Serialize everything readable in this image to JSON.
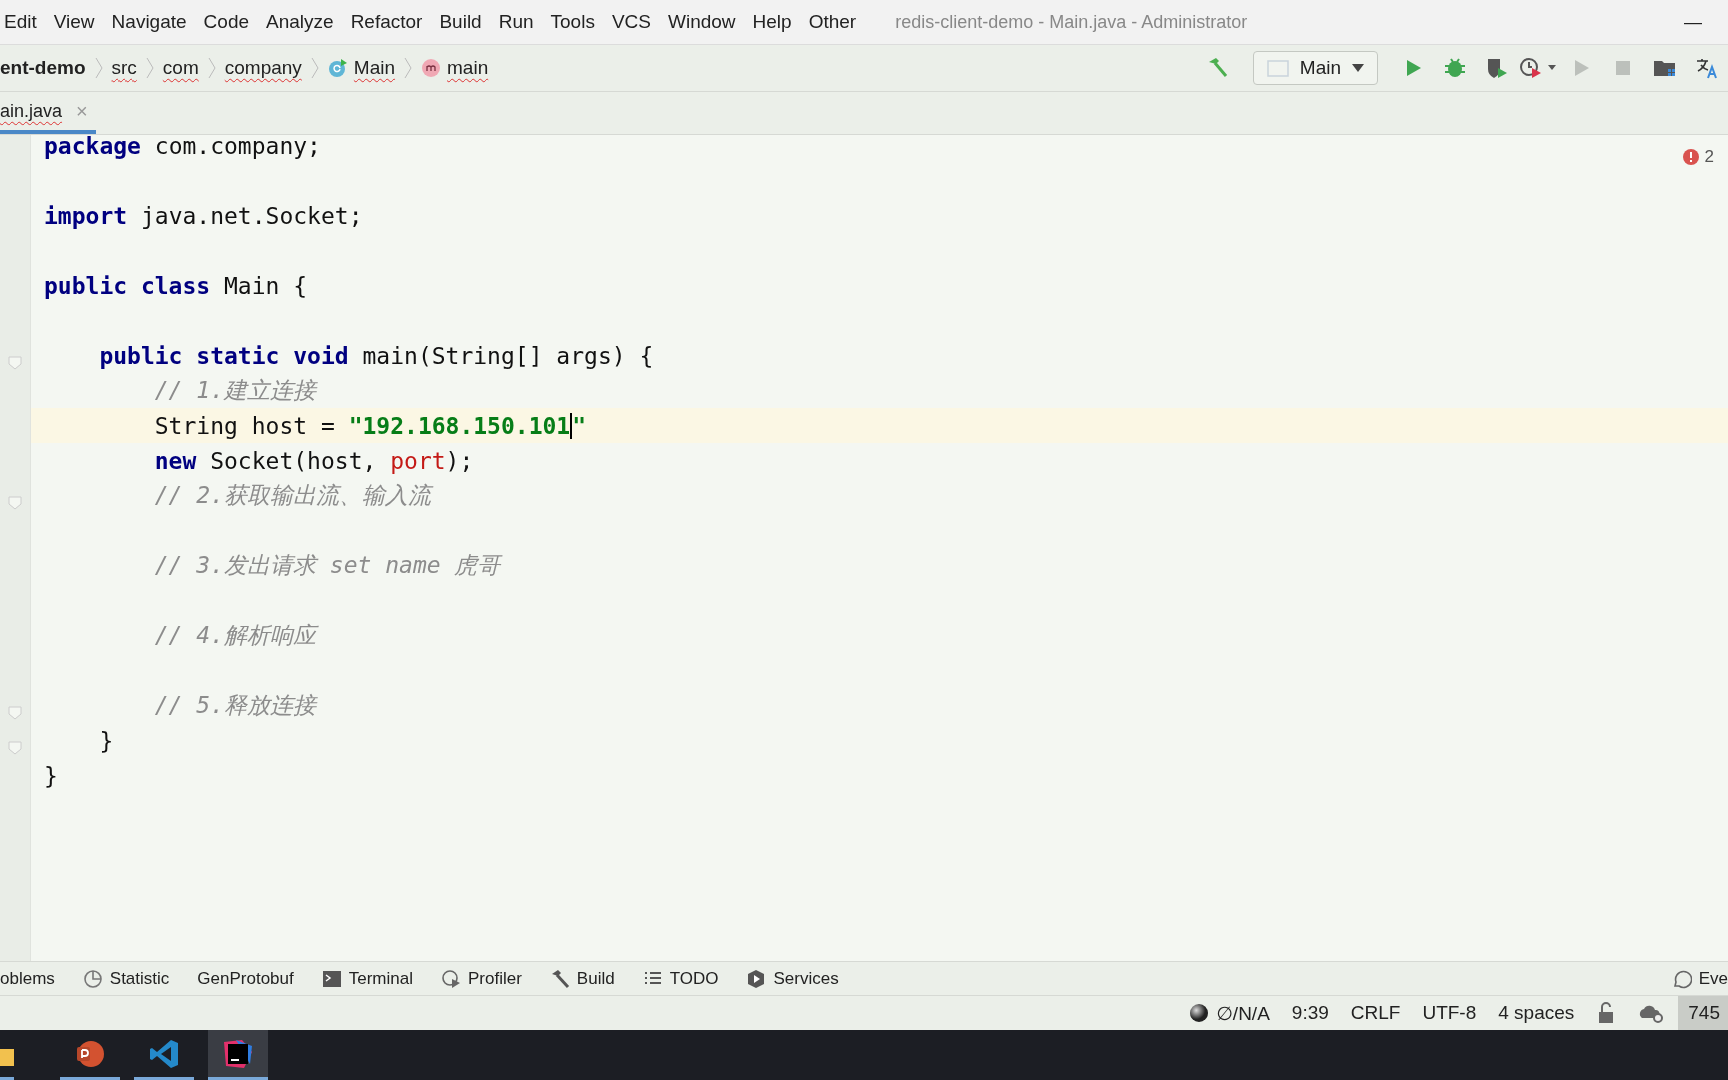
{
  "menu": [
    "Edit",
    "View",
    "Navigate",
    "Code",
    "Analyze",
    "Refactor",
    "Build",
    "Run",
    "Tools",
    "VCS",
    "Window",
    "Help",
    "Other"
  ],
  "window": {
    "title": "redis-client-demo - Main.java - Administrator",
    "minimize": "—"
  },
  "breadcrumbs": [
    {
      "label": "ent-demo",
      "kind": "project",
      "flagged": false
    },
    {
      "label": "src",
      "kind": "folder",
      "flagged": true
    },
    {
      "label": "com",
      "kind": "folder",
      "flagged": true
    },
    {
      "label": "company",
      "kind": "folder",
      "flagged": true
    },
    {
      "label": "Main",
      "kind": "class",
      "flagged": true
    },
    {
      "label": "main",
      "kind": "method",
      "flagged": true
    }
  ],
  "run_config": {
    "label": "Main"
  },
  "toolbar": [
    {
      "kind": "build",
      "disabled": false
    },
    {
      "kind": "run",
      "disabled": false
    },
    {
      "kind": "debug",
      "disabled": false
    },
    {
      "kind": "coverage",
      "disabled": false
    },
    {
      "kind": "profile",
      "disabled": false
    },
    {
      "kind": "rerun",
      "disabled": true
    },
    {
      "kind": "stop",
      "disabled": true
    },
    {
      "kind": "structure",
      "disabled": false
    },
    {
      "kind": "translate",
      "disabled": false
    }
  ],
  "tabs": [
    {
      "label": "ain.java",
      "selected": true,
      "close": "×"
    }
  ],
  "problems": {
    "count": "2"
  },
  "code": [
    {
      "current": false,
      "fold": false,
      "tokens": [
        {
          "text": "package",
          "kind": "keyword"
        },
        {
          "text": " com.company;",
          "kind": "plain"
        }
      ]
    },
    {
      "current": false,
      "fold": false
    },
    {
      "current": false,
      "fold": false,
      "tokens": [
        {
          "text": "import",
          "kind": "keyword"
        },
        {
          "text": " java.net.Socket;",
          "kind": "plain"
        }
      ]
    },
    {
      "current": false,
      "fold": false
    },
    {
      "current": false,
      "fold": false,
      "tokens": [
        {
          "text": "public class",
          "kind": "keyword"
        },
        {
          "text": " Main {",
          "kind": "plain"
        }
      ]
    },
    {
      "current": false,
      "fold": false
    },
    {
      "current": false,
      "fold": true,
      "tokens": [
        {
          "text": "    public static void",
          "kind": "keyword"
        },
        {
          "text": " main(String[] args) {",
          "kind": "plain"
        }
      ]
    },
    {
      "current": false,
      "fold": false,
      "tokens": [
        {
          "text": "        // 1.建立连接",
          "kind": "comment"
        }
      ]
    },
    {
      "current": true,
      "fold": false,
      "tokens": [
        {
          "text": "        String host = ",
          "kind": "plain"
        },
        {
          "text": "\"192.168.150.101",
          "kind": "string",
          "caret": true
        },
        {
          "text": "\"",
          "kind": "string",
          "caret": false
        }
      ]
    },
    {
      "current": false,
      "fold": false,
      "tokens": [
        {
          "text": "        new",
          "kind": "keyword"
        },
        {
          "text": " Socket(host, ",
          "kind": "plain"
        },
        {
          "text": "port",
          "kind": "error"
        },
        {
          "text": ");",
          "kind": "plain"
        }
      ]
    },
    {
      "current": false,
      "fold": true,
      "tokens": [
        {
          "text": "        // 2.获取输出流、输入流",
          "kind": "comment"
        }
      ]
    },
    {
      "current": false,
      "fold": false
    },
    {
      "current": false,
      "fold": false,
      "tokens": [
        {
          "text": "        // 3.发出请求 set name 虎哥",
          "kind": "comment"
        }
      ]
    },
    {
      "current": false,
      "fold": false
    },
    {
      "current": false,
      "fold": false,
      "tokens": [
        {
          "text": "        // 4.解析响应",
          "kind": "comment"
        }
      ]
    },
    {
      "current": false,
      "fold": false
    },
    {
      "current": false,
      "fold": true,
      "tokens": [
        {
          "text": "        // 5.释放连接",
          "kind": "comment"
        }
      ]
    },
    {
      "current": false,
      "fold": true,
      "tokens": [
        {
          "text": "    }",
          "kind": "plain"
        }
      ]
    },
    {
      "current": false,
      "fold": false,
      "tokens": [
        {
          "text": "}",
          "kind": "plain"
        }
      ]
    }
  ],
  "tool_windows": [
    {
      "label": "oblems",
      "kind": "none"
    },
    {
      "label": "Statistic",
      "kind": "pie"
    },
    {
      "label": "GenProtobuf",
      "kind": "none"
    },
    {
      "label": "Terminal",
      "kind": "terminal"
    },
    {
      "label": "Profiler",
      "kind": "profiler"
    },
    {
      "label": "Build",
      "kind": "hammer"
    },
    {
      "label": "TODO",
      "kind": "list"
    },
    {
      "label": "Services",
      "kind": "services"
    }
  ],
  "event_log": {
    "label": "Eve"
  },
  "status_bar": [
    {
      "label": "∅/N/A",
      "kind": "git"
    },
    {
      "label": "9:39",
      "kind": "text"
    },
    {
      "label": "CRLF",
      "kind": "text"
    },
    {
      "label": "UTF-8",
      "kind": "text"
    },
    {
      "label": "4 spaces",
      "kind": "text"
    },
    {
      "kind": "lock"
    },
    {
      "kind": "cloud"
    },
    {
      "label": "745",
      "kind": "memory"
    }
  ],
  "taskbar": [
    {
      "kind": "folder",
      "selected": false
    },
    {
      "kind": "slides",
      "selected": false
    },
    {
      "kind": "vscode",
      "selected": false
    },
    {
      "kind": "ide",
      "selected": true
    }
  ]
}
